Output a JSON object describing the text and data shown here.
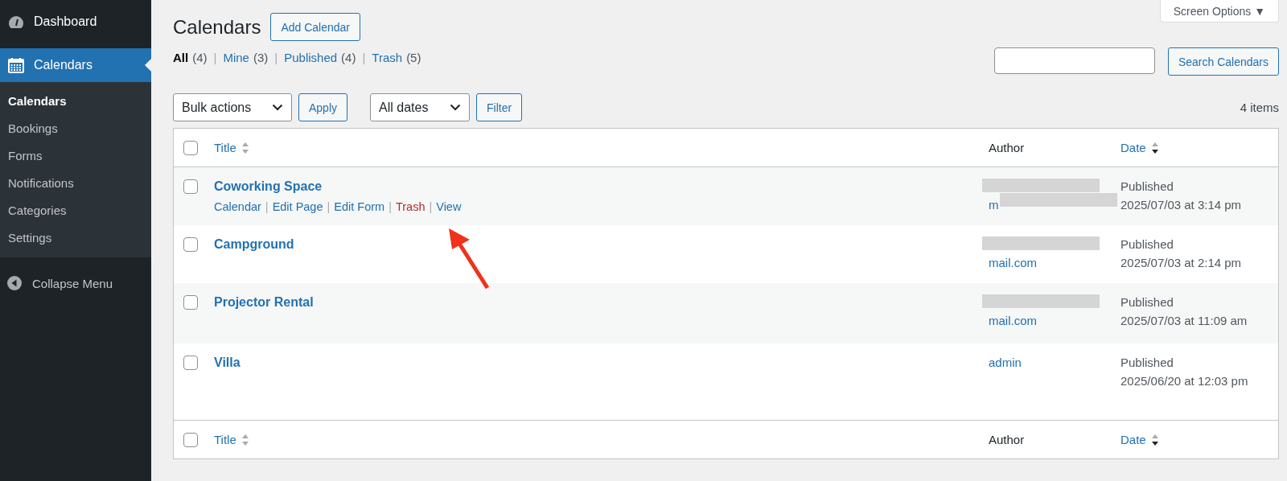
{
  "sidebar": {
    "items": [
      {
        "label": "Dashboard",
        "selected": false
      },
      {
        "label": "Calendars",
        "selected": true,
        "children": [
          {
            "label": "Calendars",
            "selected": true
          },
          {
            "label": "Bookings",
            "selected": false
          },
          {
            "label": "Forms",
            "selected": false
          },
          {
            "label": "Notifications",
            "selected": false
          },
          {
            "label": "Categories",
            "selected": false
          },
          {
            "label": "Settings",
            "selected": false
          }
        ]
      }
    ],
    "collapse": "Collapse Menu"
  },
  "screen_options": "Screen Options ▼",
  "header": {
    "title": "Calendars",
    "add_button": "Add Calendar"
  },
  "views": [
    {
      "label": "All",
      "count": "(4)",
      "selected": true
    },
    {
      "separator": "|",
      "label": "Mine",
      "count": "(3)",
      "selected": false
    },
    {
      "separator": "|",
      "label": "Published",
      "count": "(4)",
      "selected": false
    },
    {
      "separator": "|",
      "label": "Trash",
      "count": "(5)",
      "selected": false
    }
  ],
  "search": {
    "button": "Search Calendars"
  },
  "bulk": {
    "select": "Bulk actions",
    "apply": "Apply",
    "dates": "All dates",
    "filter": "Filter",
    "count": "4 items"
  },
  "table": {
    "columns": [
      {
        "label": "Title",
        "kind": "sortable",
        "sorted": false
      },
      {
        "label": "Author",
        "kind": "plain"
      },
      {
        "label": "Date",
        "kind": "sortable",
        "sorted": true
      }
    ],
    "footer_columns": [
      {
        "label": "Title",
        "kind": "sortable",
        "sorted": false
      },
      {
        "label": "Author",
        "kind": "plain"
      },
      {
        "label": "Date",
        "kind": "sortable",
        "sorted": true
      }
    ],
    "select_all_checked": false,
    "rows": [
      {
        "title": "Coworking Space",
        "checked": false,
        "actions": [
          {
            "label": "Calendar",
            "kind": "link"
          },
          {
            "separator": "|",
            "label": "Edit Page",
            "kind": "link"
          },
          {
            "separator": "|",
            "label": "Edit Form",
            "kind": "link"
          },
          {
            "separator": "|",
            "label": "Trash",
            "kind": "danger"
          },
          {
            "separator": "|",
            "label": "View",
            "kind": "link"
          }
        ],
        "author": "m",
        "kind": "redacted_both",
        "status": "Published",
        "date": "2025/07/03 at 3:14 pm"
      },
      {
        "title": "Campground",
        "checked": false,
        "author": "mail.com",
        "kind": "redacted_first",
        "status": "Published",
        "date": "2025/07/03 at 2:14 pm"
      },
      {
        "title": "Projector Rental",
        "checked": false,
        "author": "mail.com",
        "kind": "redacted_first",
        "status": "Published",
        "date": "2025/07/03 at 11:09 am"
      },
      {
        "title": "Villa",
        "checked": false,
        "author": "admin",
        "kind": "plain",
        "status": "Published",
        "date": "2025/06/20 at 12:03 pm"
      }
    ]
  }
}
